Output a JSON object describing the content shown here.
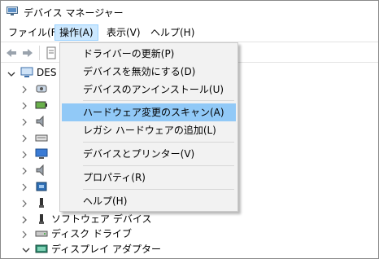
{
  "window": {
    "title": "デバイス マネージャー",
    "icon": "device-manager-icon"
  },
  "menubar": {
    "items": [
      {
        "label": "ファイル(F)"
      },
      {
        "label": "操作(A)",
        "active": true
      },
      {
        "label": "表示(V)"
      },
      {
        "label": "ヘルプ(H)"
      }
    ]
  },
  "toolbar": {
    "buttons": [
      {
        "icon": "back-arrow-icon"
      },
      {
        "icon": "forward-arrow-icon"
      },
      {
        "icon": "properties-icon"
      }
    ]
  },
  "tree": {
    "root_label": "DES",
    "categories": [
      {
        "label": "",
        "icon": "audio-input-icon"
      },
      {
        "label": "",
        "icon": "battery-icon"
      },
      {
        "label": "",
        "icon": "speaker-icon"
      },
      {
        "label": "",
        "icon": "keyboard-icon"
      },
      {
        "label": "",
        "icon": "monitor-icon"
      },
      {
        "label": "",
        "icon": "speaker-icon"
      },
      {
        "label": "",
        "icon": "network-adapter-icon"
      },
      {
        "label": "",
        "icon": "usb-icon"
      },
      {
        "label": "",
        "icon": "usb-icon"
      },
      {
        "label": "ソフトウェア デバイス",
        "icon": "software-device-icon"
      },
      {
        "label": "ディスク ドライブ",
        "icon": "disk-drive-icon"
      },
      {
        "label": "ディスプレイ アダプター",
        "icon": "display-adapter-icon",
        "expanded": true
      }
    ]
  },
  "dropdown": {
    "menu": "操作(A)",
    "items": [
      {
        "label": "ドライバーの更新(P)"
      },
      {
        "label": "デバイスを無効にする(D)"
      },
      {
        "label": "デバイスのアンインストール(U)"
      },
      {
        "label": "ハードウェア変更のスキャン(A)",
        "highlighted": true
      },
      {
        "label": "レガシ ハードウェアの追加(L)"
      },
      {
        "label": "デバイスとプリンター(V)"
      },
      {
        "label": "プロパティ(R)"
      },
      {
        "label": "ヘルプ(H)"
      }
    ]
  }
}
